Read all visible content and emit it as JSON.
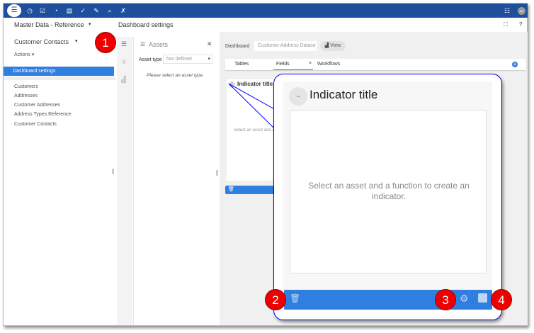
{
  "topbar": {
    "icons": [
      "database-icon",
      "clock-icon",
      "checklist-icon",
      "gauge-icon",
      "data-stack-icon",
      "task-check-icon",
      "plug-icon",
      "search-icon",
      "wrench-icon"
    ],
    "right_icons": [
      "list-icon",
      "avatar"
    ],
    "avatar_initials": "AD"
  },
  "header": {
    "app_title": "Master Data - Reference",
    "page_title": "Dashboard settings",
    "fullscreen_icon": "expand-icon",
    "help": "?"
  },
  "sidebar": {
    "entity": "Customer Contacts",
    "actions": "Actions",
    "active": "Dashboard settings",
    "items": [
      "Customers",
      "Addresses",
      "Customer Addresses",
      "Address Types Reference",
      "Customer Contacts"
    ]
  },
  "assets": {
    "title": "Assets",
    "asset_type_label": "Asset type",
    "asset_type_value": "Not defined",
    "empty": "Please select an asset type."
  },
  "dashboard": {
    "label": "Dashboard",
    "select_value": "Customer Address Datase",
    "view_button": "View",
    "tabs": [
      "Tables",
      "Fields",
      "Workflows"
    ],
    "active_tab": "Fields"
  },
  "indicator": {
    "title": "Indicator title",
    "empty_message": "Select an asset and a function to create an indicator."
  },
  "callouts": [
    "1",
    "2",
    "3",
    "4"
  ],
  "colors": {
    "brand": "#1d4f9c",
    "accent": "#2f7fe0",
    "callout": "#e00000",
    "callout_border": "#0000ff"
  }
}
